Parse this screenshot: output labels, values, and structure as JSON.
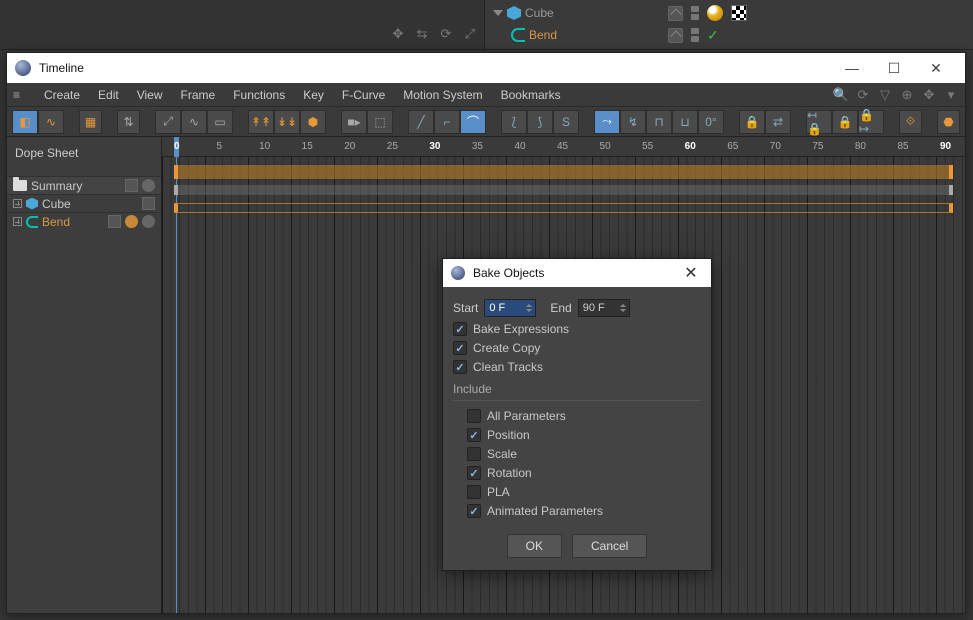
{
  "object_manager": {
    "items": [
      {
        "name": "Cube",
        "type": "cube",
        "tags": [
          "material-sphere",
          "uvw-checker"
        ]
      },
      {
        "name": "Bend",
        "type": "deformer",
        "child": true
      }
    ]
  },
  "timeline_window": {
    "title": "Timeline",
    "menubar": [
      "Create",
      "Edit",
      "View",
      "Frame",
      "Functions",
      "Key",
      "F-Curve",
      "Motion System",
      "Bookmarks"
    ],
    "mode_label": "Dope Sheet",
    "tracks": {
      "summary_label": "Summary",
      "items": [
        {
          "name": "Cube",
          "kind": "cube"
        },
        {
          "name": "Bend",
          "kind": "deformer"
        }
      ]
    },
    "ruler": {
      "start": 0,
      "end": 90,
      "step": 5,
      "bold": [
        0,
        30,
        60,
        90
      ],
      "playhead": 0
    }
  },
  "dialog": {
    "title": "Bake Objects",
    "start_label": "Start",
    "start_value": "0 F",
    "end_label": "End",
    "end_value": "90 F",
    "opts": {
      "bake_expressions": {
        "label": "Bake Expressions",
        "checked": true
      },
      "create_copy": {
        "label": "Create Copy",
        "checked": true
      },
      "clean_tracks": {
        "label": "Clean Tracks",
        "checked": true
      }
    },
    "include_label": "Include",
    "include": {
      "all_parameters": {
        "label": "All Parameters",
        "checked": false
      },
      "position": {
        "label": "Position",
        "checked": true
      },
      "scale": {
        "label": "Scale",
        "checked": false
      },
      "rotation": {
        "label": "Rotation",
        "checked": true
      },
      "pla": {
        "label": "PLA",
        "checked": false
      },
      "animated_parameters": {
        "label": "Animated Parameters",
        "checked": true
      }
    },
    "ok_label": "OK",
    "cancel_label": "Cancel"
  }
}
